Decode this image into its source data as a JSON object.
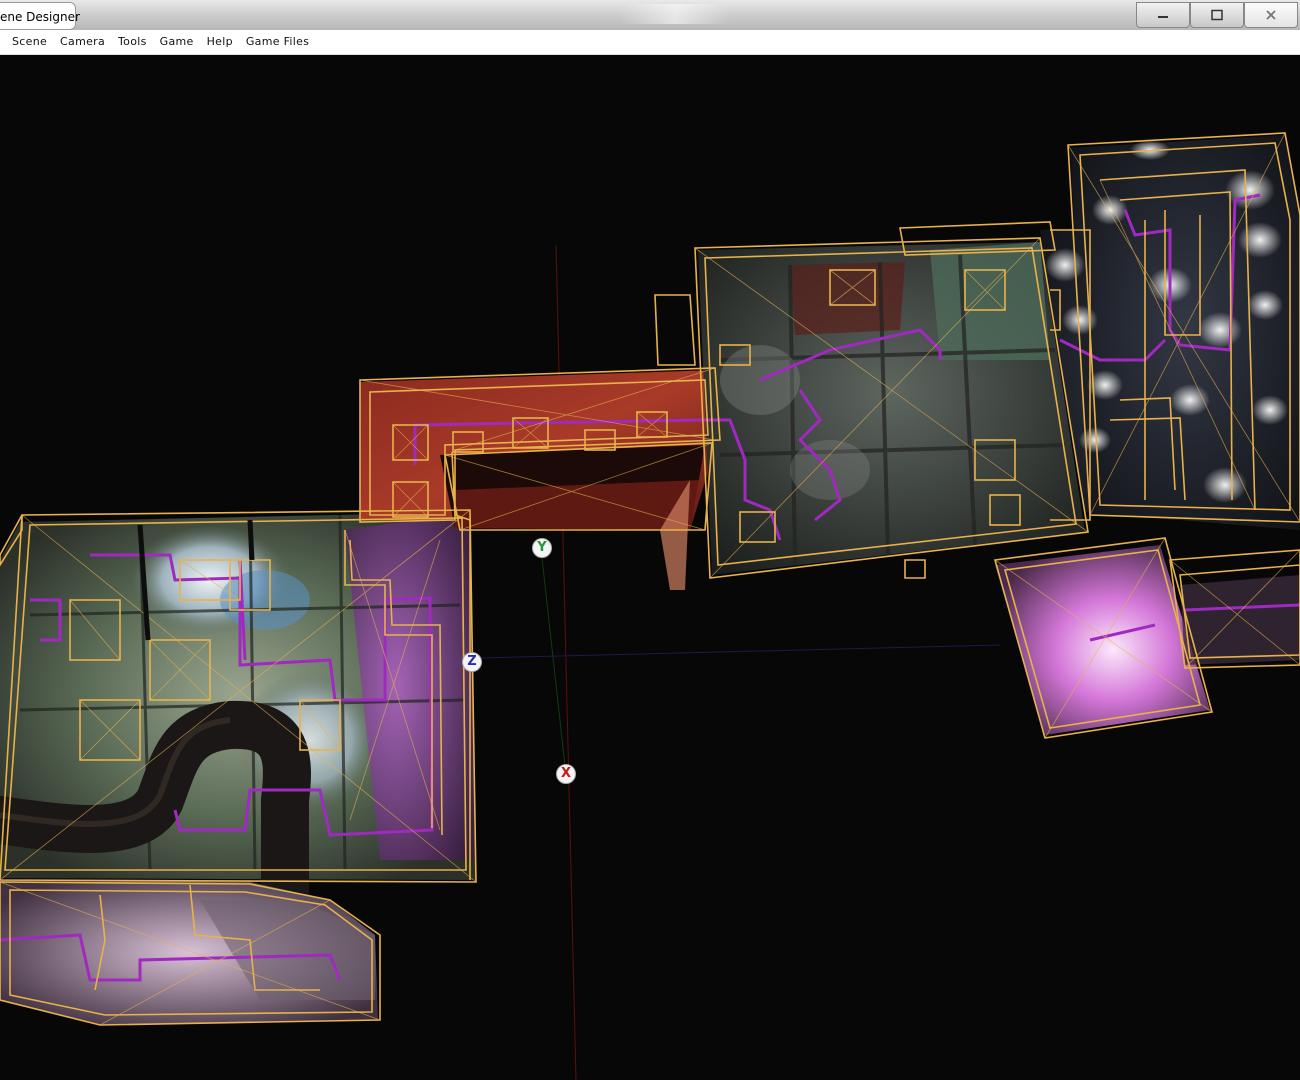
{
  "window": {
    "title": "ene Designer"
  },
  "menu": {
    "items": [
      "Scene",
      "Camera",
      "Tools",
      "Game",
      "Help",
      "Game Files"
    ]
  },
  "viewport": {
    "axes": {
      "y": "Y",
      "z": "Z",
      "x": "X"
    },
    "colors": {
      "background": "#070707",
      "wireframe": "#e7b24c",
      "path": "#a02ac0",
      "axis_y": "#1f9a3a",
      "axis_z": "#2a2ab8",
      "axis_x": "#c41a1a"
    }
  }
}
